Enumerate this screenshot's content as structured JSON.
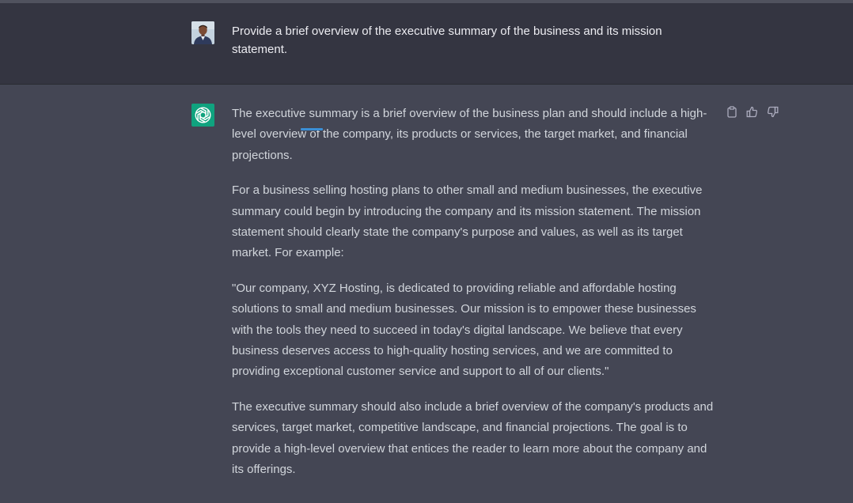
{
  "user_message": {
    "text": "Provide a brief overview of the executive summary of the business and its mission statement."
  },
  "assistant_message": {
    "paragraphs": [
      "The executive summary is a brief overview of the business plan and should include a high-level overview of the company, its products or services, the target market, and financial projections.",
      "For a business selling hosting plans to other small and medium businesses, the executive summary could begin by introducing the company and its mission statement. The mission statement should clearly state the company's purpose and values, as well as its target market. For example:",
      "\"Our company, XYZ Hosting, is dedicated to providing reliable and affordable hosting solutions to small and medium businesses. Our mission is to empower these businesses with the tools they need to succeed in today's digital landscape. We believe that every business deserves access to high-quality hosting services, and we are committed to providing exceptional customer service and support to all of our clients.\"",
      "The executive summary should also include a brief overview of the company's products and services, target market, competitive landscape, and financial projections. The goal is to provide a high-level overview that entices the reader to learn more about the company and its offerings."
    ]
  },
  "actions": {
    "copy_icon": "clipboard-icon",
    "like_icon": "thumbs-up-icon",
    "dislike_icon": "thumbs-down-icon"
  },
  "colors": {
    "user_row_bg": "#343541",
    "assistant_row_bg": "#444654",
    "ai_avatar_bg": "#10a37f",
    "text_primary": "#ececf1",
    "text_secondary": "#d1d5db"
  }
}
